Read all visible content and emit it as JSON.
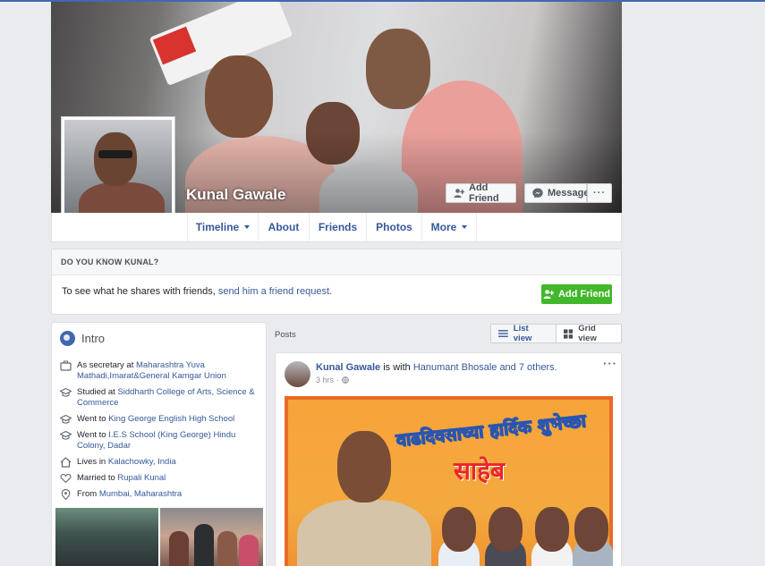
{
  "profile": {
    "name": "Kunal Gawale",
    "add_friend_label": "Add Friend",
    "message_label": "Message",
    "more_label": "···"
  },
  "tabs": [
    {
      "label": "Timeline"
    },
    {
      "label": "About"
    },
    {
      "label": "Friends"
    },
    {
      "label": "Photos"
    },
    {
      "label": "More"
    }
  ],
  "know_box": {
    "heading": "DO YOU KNOW KUNAL?",
    "text_prefix": "To see what he shares with friends,",
    "link_text": "send him a friend request.",
    "button_label": "Add Friend"
  },
  "intro": {
    "title": "Intro",
    "items": [
      {
        "icon": "briefcase-icon",
        "prefix": "As secretary at",
        "link": "Maharashtra Yuva Mathadi,Imarat&General Kamgar Union"
      },
      {
        "icon": "graduation-cap-icon",
        "prefix": "Studied at",
        "link": "Siddharth College of Arts, Science & Commerce"
      },
      {
        "icon": "graduation-cap-icon",
        "prefix": "Went to",
        "link": "King George English High School"
      },
      {
        "icon": "graduation-cap-icon",
        "prefix": "Went to",
        "link": "I.E.S School (King George) Hindu Colony, Dadar"
      },
      {
        "icon": "home-icon",
        "prefix": "Lives in",
        "link": "Kalachowky, India"
      },
      {
        "icon": "heart-icon",
        "prefix": "Married to",
        "link": "Rupali Kunal"
      },
      {
        "icon": "location-pin-icon",
        "prefix": "From",
        "link": "Mumbai, Maharashtra"
      }
    ]
  },
  "posts": {
    "label": "Posts",
    "list_view_label": "List view",
    "grid_view_label": "Grid view",
    "post": {
      "author": "Kunal Gawale",
      "with_text": "is with",
      "tagged": "Hanumant Bhosale and 7 others.",
      "time": "3 hrs",
      "more_label": "···",
      "poster_title": "वाढदिवसाच्या हार्दिक शुभेच्छा",
      "poster_subtitle": "साहेब"
    }
  },
  "colors": {
    "accent": "#4267b2",
    "link": "#365899",
    "green_button": "#42b72a",
    "page_bg": "#e9ebee"
  }
}
